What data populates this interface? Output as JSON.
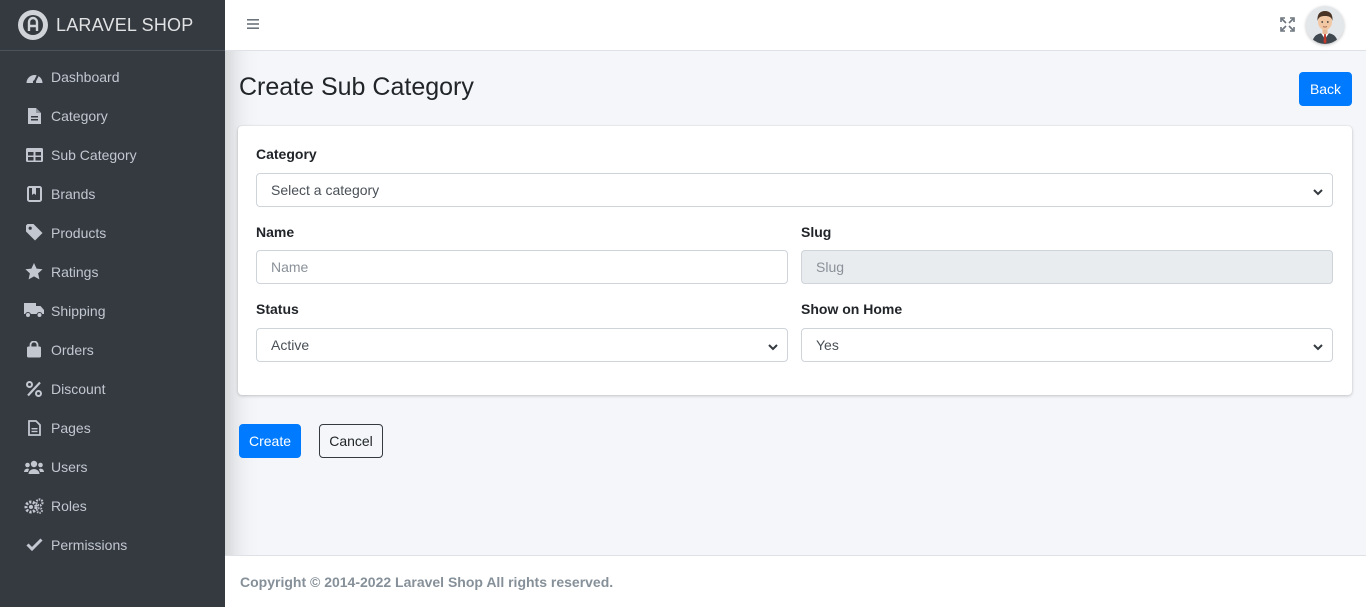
{
  "brand": {
    "name": "LARAVEL SHOP",
    "logo_icon": "brand-logo-icon"
  },
  "sidebar": {
    "items": [
      {
        "label": "Dashboard",
        "icon": "tachometer-icon"
      },
      {
        "label": "Category",
        "icon": "file-icon"
      },
      {
        "label": "Sub Category",
        "icon": "table-icon"
      },
      {
        "label": "Brands",
        "icon": "book-icon"
      },
      {
        "label": "Products",
        "icon": "tag-icon"
      },
      {
        "label": "Ratings",
        "icon": "star-icon"
      },
      {
        "label": "Shipping",
        "icon": "truck-icon"
      },
      {
        "label": "Orders",
        "icon": "shopping-bag-icon"
      },
      {
        "label": "Discount",
        "icon": "percent-icon"
      },
      {
        "label": "Pages",
        "icon": "file-alt-icon"
      },
      {
        "label": "Users",
        "icon": "users-icon"
      },
      {
        "label": "Roles",
        "icon": "cogs-icon"
      },
      {
        "label": "Permissions",
        "icon": "check-icon"
      }
    ]
  },
  "topbar": {
    "menu_icon": "hamburger-icon",
    "fullscreen_icon": "expand-icon",
    "avatar_icon": "user-avatar-icon"
  },
  "page": {
    "title": "Create Sub Category",
    "back_label": "Back"
  },
  "form": {
    "category": {
      "label": "Category",
      "value": "Select a category"
    },
    "name": {
      "label": "Name",
      "placeholder": "Name"
    },
    "slug": {
      "label": "Slug",
      "placeholder": "Slug"
    },
    "status": {
      "label": "Status",
      "value": "Active"
    },
    "show_on_home": {
      "label": "Show on Home",
      "value": "Yes"
    }
  },
  "actions": {
    "create_label": "Create",
    "cancel_label": "Cancel"
  },
  "footer": {
    "text": "Copyright © 2014-2022 Laravel Shop All rights reserved."
  },
  "colors": {
    "sidebar_bg": "#343a40",
    "primary": "#007bff",
    "content_bg": "#f4f6f9"
  }
}
